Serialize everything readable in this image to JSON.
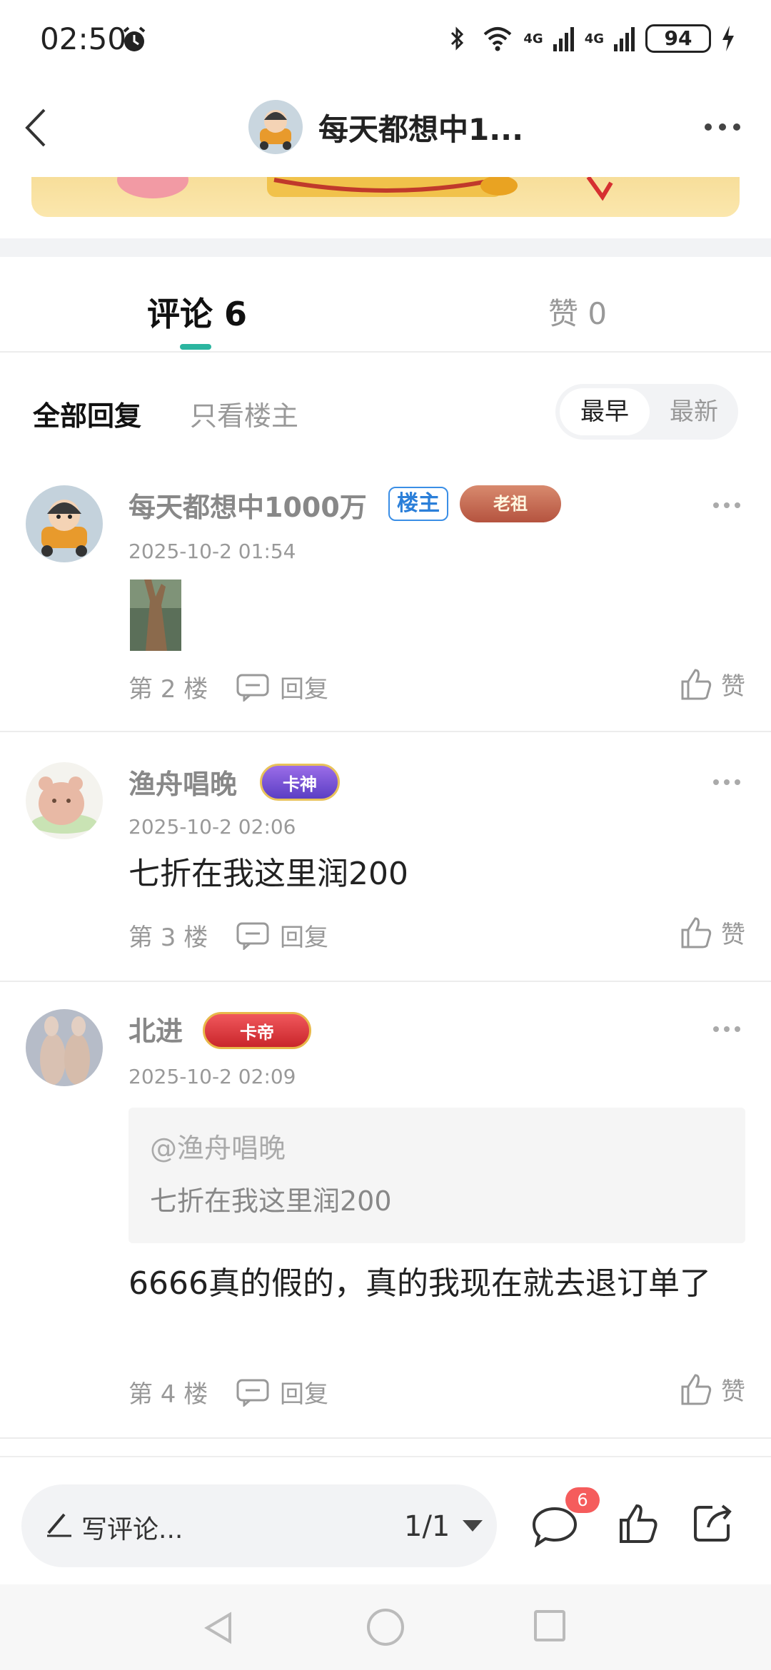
{
  "status_bar": {
    "time": "02:50",
    "battery": "94",
    "network_1": "4G",
    "network_2": "4G"
  },
  "header": {
    "title": "每天都想中1..."
  },
  "tabs": {
    "comments": "评论 6",
    "likes": "赞 0"
  },
  "filter": {
    "all": "全部回复",
    "owner_only": "只看楼主",
    "sort_earliest": "最早",
    "sort_latest": "最新"
  },
  "comments": [
    {
      "user": "每天都想中1000万",
      "owner_badge": "楼主",
      "medal": "老祖",
      "time": "2025-10-2 01:54",
      "floor": "第 2 楼",
      "reply": "回复",
      "like": "赞"
    },
    {
      "user": "渔舟唱晚",
      "medal": "卡神",
      "time": "2025-10-2 02:06",
      "text": "七折在我这里润200",
      "floor": "第 3 楼",
      "reply": "回复",
      "like": "赞"
    },
    {
      "user": "北进",
      "medal": "卡帝",
      "time": "2025-10-2 02:09",
      "quote_user": "@渔舟唱晚",
      "quote_text": "七折在我这里润200",
      "text": "6666真的假的，真的我现在就去退订单了",
      "floor": "第 4 楼",
      "reply": "回复",
      "like": "赞"
    }
  ],
  "bottom_bar": {
    "write_placeholder": "写评论...",
    "page": "1/1",
    "comment_count": "6"
  },
  "colors": {
    "accent": "#2bb5a0",
    "owner_badge": "#2b7fd9",
    "badge_red": "#f55c5c"
  }
}
